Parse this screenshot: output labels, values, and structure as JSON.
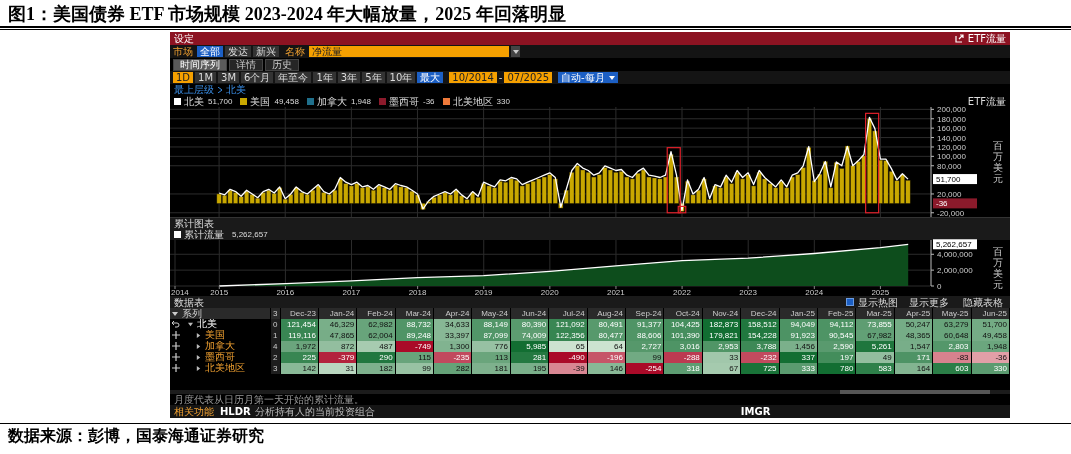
{
  "figure_title": "图1：美国债券 ETF 市场规模 2023-2024 年大幅放量，2025 年回落明显",
  "terminal": {
    "title": "设定",
    "function_name": "ETF流量",
    "filters": {
      "market_label": "市场",
      "market_options": [
        {
          "label": "全部",
          "selected": true
        },
        {
          "label": "发达",
          "selected": false
        },
        {
          "label": "新兴",
          "selected": false
        }
      ],
      "metric_label": "名称",
      "metric_value": "净流量"
    },
    "tabs": [
      {
        "label": "时间序列",
        "selected": true
      },
      {
        "label": "详情",
        "selected": false
      },
      {
        "label": "历史",
        "selected": false
      }
    ],
    "period_label": "1D",
    "periods": [
      {
        "label": "1M",
        "selected": false
      },
      {
        "label": "3M",
        "selected": false
      },
      {
        "label": "6个月",
        "selected": false
      },
      {
        "label": "年至今",
        "selected": false
      },
      {
        "label": "1年",
        "selected": false
      },
      {
        "label": "3年",
        "selected": false
      },
      {
        "label": "5年",
        "selected": false
      },
      {
        "label": "10年",
        "selected": false
      },
      {
        "label": "最大",
        "selected": true
      }
    ],
    "date_from": "10/2014",
    "date_separator": "-",
    "date_to": "07/2025",
    "frequency": "自动-每月",
    "breadcrumb": [
      "最上层级",
      "北美"
    ],
    "legend": [
      {
        "name": "北美",
        "value": "51,700",
        "color": "#ffffff"
      },
      {
        "name": "美国",
        "value": "49,458",
        "color": "#c9a800"
      },
      {
        "name": "加拿大",
        "value": "1,948",
        "color": "#1f6f8b"
      },
      {
        "name": "墨西哥",
        "value": "-36",
        "color": "#8b1a2b"
      },
      {
        "name": "北美地区",
        "value": "330",
        "color": "#f07a3a"
      }
    ],
    "flow_chart": {
      "title": "ETF流量",
      "axis_label": "百万美元",
      "chart_data": {
        "type": "bar",
        "categories": [
          null,
          null,
          null,
          null,
          null,
          null,
          null,
          null,
          null,
          null,
          null,
          null,
          null,
          null,
          null,
          null,
          null,
          null,
          null,
          null,
          null,
          null,
          null,
          null,
          null,
          null,
          null,
          null,
          null,
          null,
          null,
          null,
          null,
          null,
          null,
          null,
          null,
          null,
          null,
          null,
          null,
          null,
          null,
          null,
          null,
          null,
          null,
          null,
          null,
          null,
          null,
          null,
          null,
          null,
          null,
          null,
          null,
          null,
          null,
          null,
          null,
          null,
          null,
          null,
          null,
          null,
          null,
          null,
          null,
          null,
          null,
          null,
          null,
          null,
          null,
          null,
          null,
          null,
          null,
          null,
          null,
          null,
          null,
          null,
          null,
          null,
          null,
          null,
          null,
          null,
          null,
          null,
          null,
          null,
          null,
          null,
          null,
          null,
          null,
          null,
          null,
          null,
          null,
          null,
          null,
          null,
          null,
          null,
          null,
          null,
          null,
          null,
          null,
          null,
          null,
          null,
          null,
          null,
          null,
          null,
          null,
          null,
          null,
          null,
          null,
          null
        ],
        "ylim": [
          -29000,
          205000
        ],
        "yticks": [
          {
            "value": -20000,
            "label": "-20,000"
          },
          {
            "value": 20000,
            "label": "20,000"
          },
          {
            "value": 80000,
            "label": "80,000"
          },
          {
            "value": 100000,
            "label": "100,000"
          },
          {
            "value": 120000,
            "label": "120,000"
          },
          {
            "value": 140000,
            "label": "140,000"
          },
          {
            "value": 160000,
            "label": "160,000"
          },
          {
            "value": 180000,
            "label": "180,000"
          },
          {
            "value": 200000,
            "label": "200,000"
          }
        ],
        "series": [
          {
            "type": "bar",
            "color": "#c9a800",
            "values": [
              20000,
              17000,
              28000,
              23000,
              14000,
              26000,
              19000,
              11000,
              23000,
              28000,
              21000,
              33000,
              9000,
              19000,
              33000,
              23000,
              19000,
              28000,
              37000,
              23000,
              19000,
              28000,
              52000,
              42000,
              37000,
              42000,
              33000,
              35000,
              28000,
              37000,
              33000,
              28000,
              39000,
              35000,
              33000,
              26000,
              18000,
              -13000,
              4000,
              13000,
              18000,
              23000,
              18000,
              28000,
              16000,
              8000,
              23000,
              13000,
              42000,
              37000,
              33000,
              47000,
              45000,
              52000,
              49000,
              37000,
              42000,
              47000,
              52000,
              56000,
              61000,
              52000,
              -10000,
              28000,
              66000,
              80000,
              71000,
              66000,
              56000,
              61000,
              76000,
              71000,
              66000,
              68000,
              56000,
              52000,
              64000,
              71000,
              56000,
              54000,
              52000,
              56000,
              104000,
              56000,
              -17000,
              47000,
              18000,
              28000,
              52000,
              8000,
              37000,
              33000,
              56000,
              42000,
              66000,
              52000,
              61000,
              37000,
              66000,
              52000,
              42000,
              33000,
              47000,
              33000,
              56000,
              61000,
              76000,
              119000,
              48000,
              62000,
              89000,
              33000,
              87000,
              74000,
              122000,
              80000,
              89000,
              101000,
              180000,
              154000,
              92000,
              91000,
              68000,
              48000,
              61000,
              49000
            ]
          },
          {
            "type": "line",
            "color": "#ffffff",
            "values": [
              22000,
              18000,
              30000,
              25000,
              15000,
              28000,
              20000,
              12000,
              25000,
              30000,
              22000,
              35000,
              10000,
              20000,
              35000,
              25000,
              20000,
              30000,
              40000,
              25000,
              20000,
              30000,
              55000,
              45000,
              40000,
              45000,
              35000,
              38000,
              30000,
              40000,
              35000,
              30000,
              42000,
              38000,
              35000,
              28000,
              20000,
              -12000,
              5000,
              15000,
              20000,
              25000,
              20000,
              30000,
              18000,
              10000,
              25000,
              15000,
              45000,
              40000,
              35000,
              50000,
              48000,
              55000,
              52000,
              40000,
              45000,
              50000,
              55000,
              60000,
              65000,
              55000,
              -8000,
              30000,
              70000,
              85000,
              75000,
              70000,
              60000,
              65000,
              80000,
              75000,
              70000,
              72000,
              60000,
              55000,
              68000,
              75000,
              60000,
              58000,
              55000,
              60000,
              110000,
              60000,
              -15000,
              50000,
              20000,
              30000,
              55000,
              10000,
              40000,
              35000,
              60000,
              45000,
              70000,
              55000,
              65000,
              40000,
              70000,
              55000,
              45000,
              35000,
              50000,
              35000,
              60000,
              65000,
              80000,
              121000,
              46000,
              63000,
              89000,
              35000,
              88000,
              80000,
              121000,
              80000,
              91000,
              104000,
              183000,
              159000,
              94000,
              94000,
              74000,
              50000,
              63000,
              51700
            ]
          }
        ],
        "grid": true,
        "annotations": [
          "51,700",
          "-36"
        ]
      }
    },
    "cumulative": {
      "title": "累计图表",
      "legend": {
        "name": "累计流量",
        "value": "5,262,657",
        "color": "#ffffff"
      },
      "axis_label": "百万美元",
      "chart_data": {
        "type": "area",
        "xlim": [
          2014.33,
          2025.75
        ],
        "ylim": [
          0,
          5800000
        ],
        "grid": true,
        "x": [
          2015,
          2016,
          2017,
          2018,
          2019,
          2020,
          2021,
          2022,
          2023,
          2024,
          2025,
          2025.42
        ],
        "xticks": [
          {
            "value": 2014.33,
            "label": "2014"
          },
          2015,
          2016,
          2017,
          2018,
          2019,
          2020,
          2021,
          2022,
          2023,
          2024,
          2025
        ],
        "yticks": [
          0,
          {
            "value": 2000000,
            "label": "2,000,000"
          },
          {
            "value": 4000000,
            "label": "4,000,000"
          }
        ],
        "series": [
          {
            "color": "#0d4d1c",
            "values": [
              0,
              300000,
              650000,
              1050000,
              1300000,
              1850000,
              2550000,
              3200000,
              3500000,
              4100000,
              4830000,
              5262657
            ]
          }
        ],
        "annotations": [
          "5,262,657"
        ]
      }
    },
    "table": {
      "title": "数据表",
      "toolbar": [
        {
          "label": "显示热图",
          "kind": "checkbox",
          "checked": true
        },
        {
          "label": "显示更多",
          "kind": "button"
        },
        {
          "label": "隐藏表格",
          "kind": "button"
        }
      ],
      "series_header": "系列",
      "columns": [
        "3",
        "Dec-23",
        "Jan-24",
        "Feb-24",
        "Mar-24",
        "Apr-24",
        "May-24",
        "Jun-24",
        "Jul-24",
        "Aug-24",
        "Sep-24",
        "Oct-24",
        "Nov-24",
        "Dec-24",
        "Jan-25",
        "Feb-25",
        "Mar-25",
        "Apr-25",
        "May-25",
        "Jun-25"
      ],
      "rows": [
        {
          "name": "北美",
          "expanded": true,
          "cells": [
            "0",
            "121,454",
            "46,329",
            "62,982",
            "88,732",
            "34,633",
            "88,149",
            "80,390",
            "121,092",
            "80,491",
            "91,377",
            "104,425",
            "182,873",
            "158,512",
            "94,049",
            "94,112",
            "73,855",
            "50,247",
            "63,279",
            "51,700"
          ],
          "children": [
            {
              "name": "美国",
              "expanded": false,
              "cells": [
                "1",
                "119,116",
                "47,865",
                "62,004",
                "89,248",
                "33,397",
                "87,099",
                "74,009",
                "122,356",
                "80,477",
                "88,606",
                "101,390",
                "179,821",
                "154,228",
                "91,923",
                "90,545",
                "67,982",
                "48,365",
                "60,648",
                "49,458"
              ]
            },
            {
              "name": "加拿大",
              "expanded": false,
              "cells": [
                "4",
                "1,972",
                "872",
                "487",
                "-749",
                "1,300",
                "776",
                "5,985",
                "65",
                "64",
                "2,727",
                "3,016",
                "2,953",
                "3,788",
                "1,456",
                "2,590",
                "5,261",
                "1,547",
                "2,803",
                "1,948"
              ]
            },
            {
              "name": "墨西哥",
              "expanded": false,
              "cells": [
                "2",
                "225",
                "-379",
                "290",
                "115",
                "-235",
                "113",
                "281",
                "-490",
                "-196",
                "99",
                "-288",
                "33",
                "-232",
                "337",
                "197",
                "49",
                "171",
                "-83",
                "-36"
              ]
            },
            {
              "name": "北美地区",
              "expanded": false,
              "cells": [
                "3",
                "142",
                "31",
                "182",
                "99",
                "282",
                "181",
                "195",
                "-39",
                "146",
                "-254",
                "318",
                "67",
                "725",
                "333",
                "780",
                "583",
                "164",
                "603",
                "330"
              ]
            }
          ]
        }
      ]
    },
    "note": "月度代表从日历月第一天开始的累计流量。",
    "footer": {
      "label": "相关功能",
      "items": [
        {
          "code": "HLDR",
          "text": "分析持有人的当前投资组合"
        },
        {
          "code": "IMGR"
        }
      ]
    }
  },
  "source": "数据来源：彭博，国泰海通证券研究"
}
